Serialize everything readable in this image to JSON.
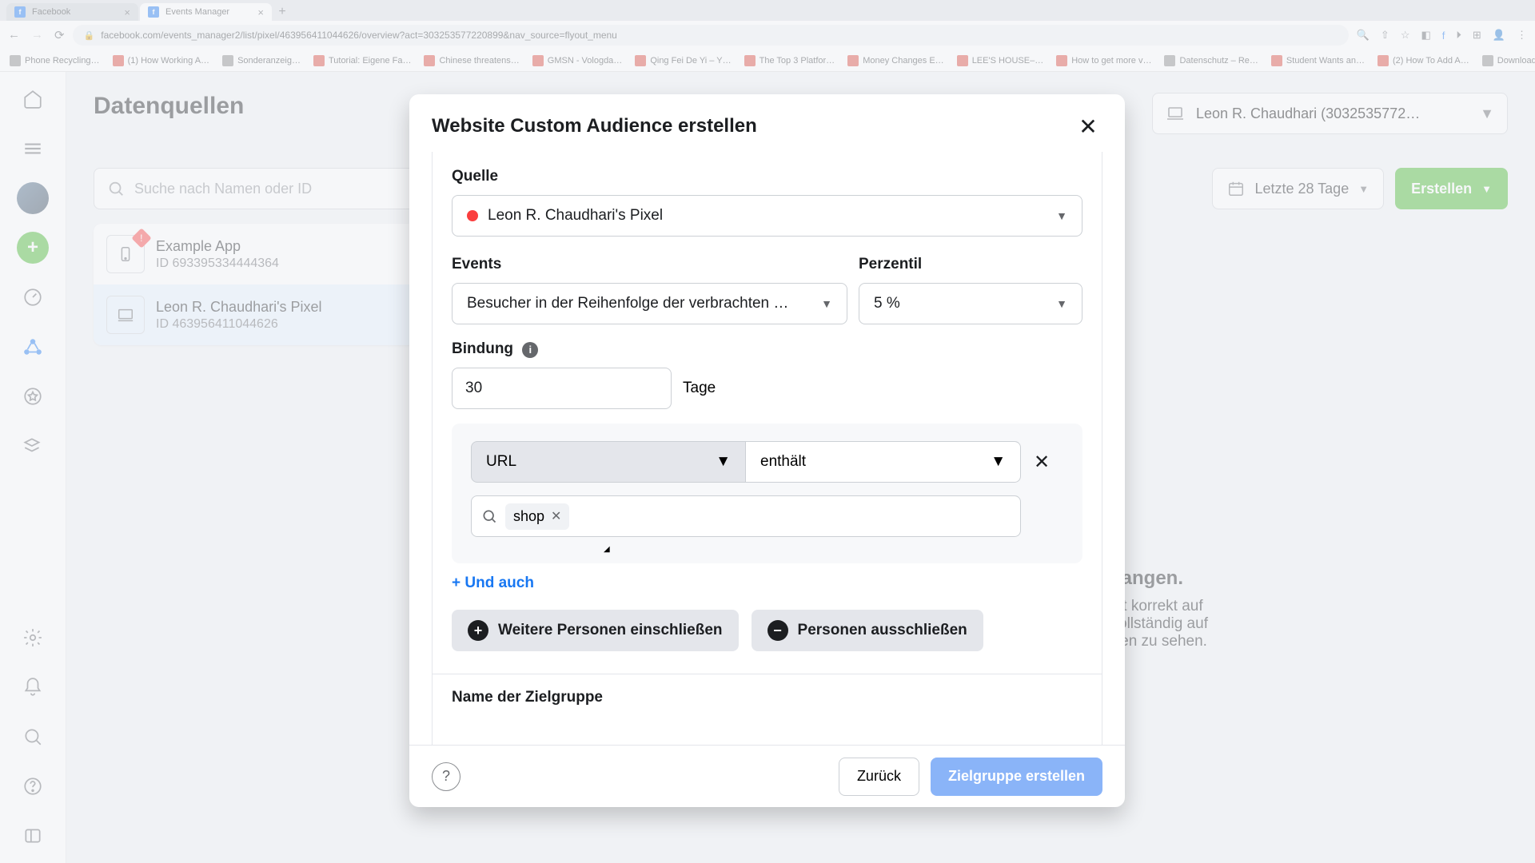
{
  "browser": {
    "tabs": [
      {
        "title": "Facebook"
      },
      {
        "title": "Events Manager"
      }
    ],
    "url": "facebook.com/events_manager2/list/pixel/463956411044626/overview?act=303253577220899&nav_source=flyout_menu",
    "bookmarks": [
      "Phone Recycling…",
      "(1) How Working A…",
      "Sonderanzeig…",
      "Tutorial: Eigene Fa…",
      "Chinese threatens…",
      "GMSN - Vologda…",
      "Qing Fei De Yi – Y…",
      "The Top 3 Platfor…",
      "Money Changes E…",
      "LEE'S HOUSE–…",
      "How to get more v…",
      "Datenschutz – Re…",
      "Student Wants an…",
      "(2) How To Add A…",
      "Download - Cooki…"
    ]
  },
  "page": {
    "title": "Datenquellen",
    "search_placeholder": "Suche nach Namen oder ID",
    "account_name": "Leon R. Chaudhari (3032535772…",
    "date_range": "Letzte 28 Tage",
    "create_button": "Erstellen"
  },
  "sources": [
    {
      "name": "Example App",
      "id_label": "ID",
      "id": "693395334444364"
    },
    {
      "name": "Leon R. Chaudhari's Pixel",
      "id_label": "ID",
      "id": "463956411044626"
    }
  ],
  "modal": {
    "title": "Website Custom Audience erstellen",
    "source_label": "Quelle",
    "source_value": "Leon R. Chaudhari's Pixel",
    "events_label": "Events",
    "events_value": "Besucher in der Reihenfolge der verbrachten …",
    "percentile_label": "Perzentil",
    "percentile_value": "5 %",
    "retention_label": "Bindung",
    "retention_value": "30",
    "retention_unit": "Tage",
    "filter_field": "URL",
    "filter_op": "enthält",
    "filter_token": "shop",
    "add_also": "+ Und auch",
    "include_more": "Weitere Personen einschließen",
    "exclude": "Personen ausschließen",
    "name_label": "Name der Zielgruppe",
    "back": "Zurück",
    "create": "Zielgruppe erstellen"
  },
  "bg": {
    "heading": "pfangen.",
    "line1": "icht korrekt auf",
    "line2": "l vollständig auf",
    "line3": "täten zu sehen."
  }
}
